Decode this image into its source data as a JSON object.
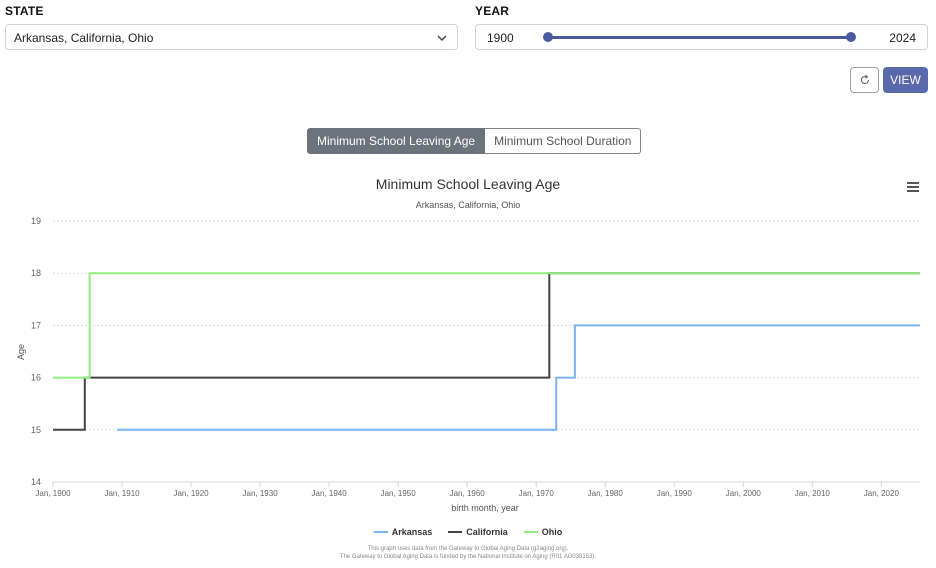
{
  "filters": {
    "state_label": "STATE",
    "state_value": "Arkansas, California, Ohio",
    "year_label": "YEAR",
    "year_min": "1900",
    "year_max": "2024"
  },
  "actions": {
    "view_label": "VIEW"
  },
  "tabs": [
    {
      "label": "Minimum School Leaving Age",
      "active": true
    },
    {
      "label": "Minimum School Duration",
      "active": false
    }
  ],
  "credits": {
    "line1": "This graph uses data from the Gateway to Global Aging Data (g2aging.org).",
    "line2": "The Gateway to Global Aging Data is funded by the National Institute on Aging (R01 AG030153)."
  },
  "chart_data": {
    "type": "line",
    "step": true,
    "title": "Minimum School Leaving Age",
    "subtitle": "Arkansas, California, Ohio",
    "xlabel": "birth month, year",
    "ylabel": "Age",
    "xlim": [
      1900,
      2025.6
    ],
    "ylim": [
      14,
      19
    ],
    "x_ticks": [
      "Jan, 1900",
      "Jan, 1910",
      "Jan, 1920",
      "Jan, 1930",
      "Jan, 1940",
      "Jan, 1950",
      "Jan, 1960",
      "Jan, 1970",
      "Jan, 1980",
      "Jan, 1990",
      "Jan, 2000",
      "Jan, 2010",
      "Jan, 2020"
    ],
    "y_ticks": [
      14,
      15,
      16,
      17,
      18,
      19
    ],
    "grid": true,
    "legend_position": "bottom-center",
    "series": [
      {
        "name": "Arkansas",
        "color": "#7cb5ec",
        "points": [
          [
            1909.3,
            15
          ],
          [
            1972.9,
            15
          ],
          [
            1972.9,
            16
          ],
          [
            1975.6,
            16
          ],
          [
            1975.6,
            17
          ],
          [
            2025.6,
            17
          ]
        ]
      },
      {
        "name": "California",
        "color": "#434348",
        "points": [
          [
            1900,
            15
          ],
          [
            1904.6,
            15
          ],
          [
            1904.6,
            16
          ],
          [
            1971.9,
            16
          ],
          [
            1971.9,
            18
          ],
          [
            2025.6,
            18
          ]
        ]
      },
      {
        "name": "Ohio",
        "color": "#90ed7d",
        "points": [
          [
            1900,
            16
          ],
          [
            1905.3,
            16
          ],
          [
            1905.3,
            18
          ],
          [
            2025.6,
            18
          ]
        ]
      }
    ]
  }
}
